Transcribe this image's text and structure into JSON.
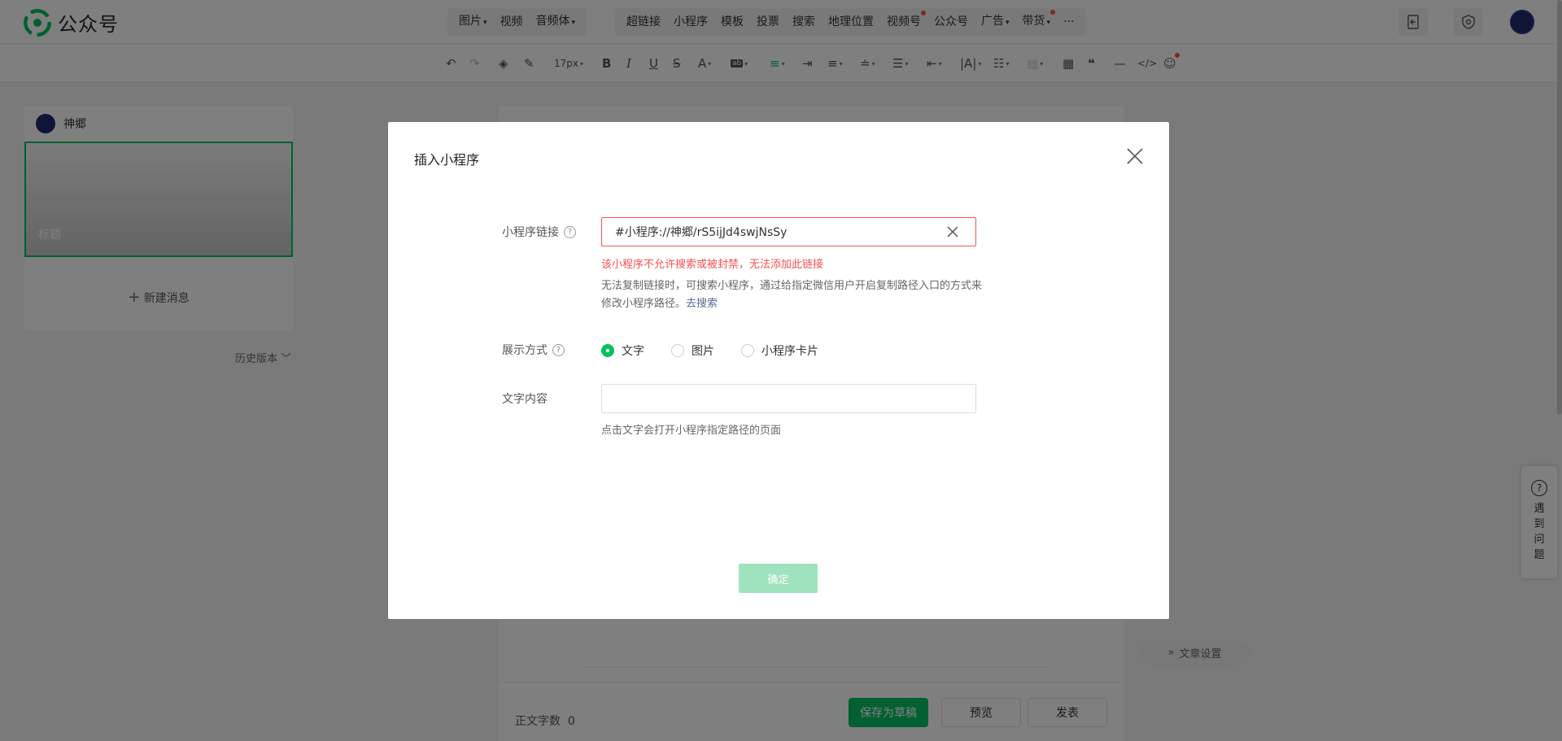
{
  "app": {
    "name": "公众号",
    "brand_color": "#07c160"
  },
  "topnav": {
    "group1": [
      {
        "label": "图片",
        "dropdown": true
      },
      {
        "label": "视频",
        "dropdown": false
      },
      {
        "label": "音频体",
        "dropdown": true
      }
    ],
    "group2": [
      {
        "label": "超链接",
        "dropdown": false,
        "dot": false
      },
      {
        "label": "小程序",
        "dropdown": false,
        "dot": false
      },
      {
        "label": "模板",
        "dropdown": false,
        "dot": false
      },
      {
        "label": "投票",
        "dropdown": false,
        "dot": false
      },
      {
        "label": "搜索",
        "dropdown": false,
        "dot": false
      },
      {
        "label": "地理位置",
        "dropdown": false,
        "dot": false
      },
      {
        "label": "视频号",
        "dropdown": false,
        "dot": true
      },
      {
        "label": "公众号",
        "dropdown": false,
        "dot": false
      },
      {
        "label": "广告",
        "dropdown": true,
        "dot": false
      },
      {
        "label": "带货",
        "dropdown": true,
        "dot": true
      },
      {
        "label": "···",
        "dropdown": false,
        "dot": false
      }
    ],
    "icons": [
      "import-document-icon",
      "security-shield-icon"
    ]
  },
  "toolbar": {
    "font_size": "17px"
  },
  "left_panel": {
    "account_name": "神郷",
    "cover_placeholder": "标题",
    "new_message": "新建消息",
    "history": "历史版本"
  },
  "editor": {
    "word_count_label": "正文字数",
    "word_count": "0",
    "save_draft": "保存为草稿",
    "preview": "预览",
    "publish": "发表",
    "article_settings": "文章设置"
  },
  "help": {
    "label": "遇到问题"
  },
  "modal": {
    "title": "插入小程序",
    "link_label": "小程序链接",
    "link_value": "#小程序://神郷/rS5ijJd4swjNsSy",
    "error": "该小程序不允许搜索或被封禁，无法添加此链接",
    "hint": "无法复制链接时，可搜索小程序，通过给指定微信用户开启复制路径入口的方式来修改小程序路径。",
    "hint_link": "去搜索",
    "display_label": "展示方式",
    "display_options": [
      "文字",
      "图片",
      "小程序卡片"
    ],
    "selected_display": "文字",
    "text_label": "文字内容",
    "text_value": "",
    "text_hint": "点击文字会打开小程序指定路径的页面",
    "confirm": "确定"
  }
}
